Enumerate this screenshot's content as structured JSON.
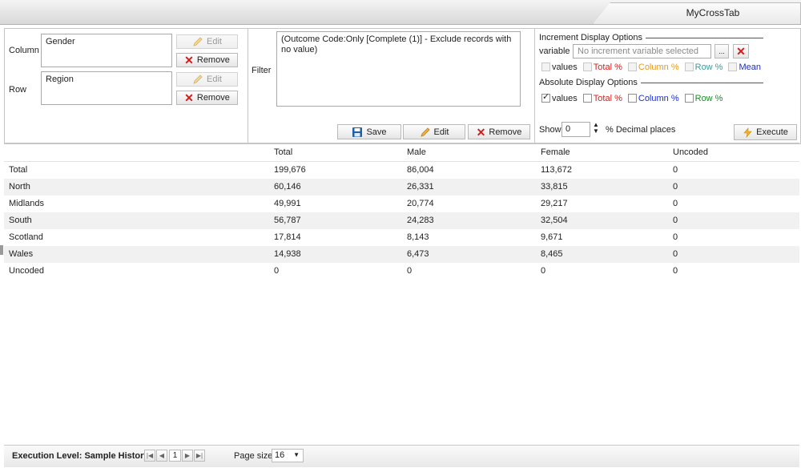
{
  "window": {
    "tab_title": "MyCrossTab"
  },
  "dimensions": {
    "column_label": "Column",
    "column_value": "Gender",
    "row_label": "Row",
    "row_value": "Region",
    "edit_label": "Edit",
    "remove_label": "Remove"
  },
  "filter": {
    "label": "Filter",
    "text": "(Outcome Code:Only [Complete (1)] - Exclude records with no value)",
    "save_label": "Save",
    "edit_label": "Edit",
    "remove_label": "Remove"
  },
  "increment": {
    "title": "Increment Display Options",
    "variable_label": "variable",
    "placeholder": "No increment variable selected",
    "browse_label": "...",
    "options": [
      {
        "label": "values",
        "color": "#222222"
      },
      {
        "label": "Total %",
        "color": "#d62020"
      },
      {
        "label": "Column %",
        "color": "#e89a1a"
      },
      {
        "label": "Row %",
        "color": "#3d9a9a"
      },
      {
        "label": "Mean",
        "color": "#2030b0"
      }
    ]
  },
  "absolute": {
    "title": "Absolute Display Options",
    "options": [
      {
        "label": "values",
        "color": "#222222",
        "checked": true
      },
      {
        "label": "Total %",
        "color": "#d62020",
        "checked": false
      },
      {
        "label": "Column %",
        "color": "#1a2fd0",
        "checked": false
      },
      {
        "label": "Row %",
        "color": "#1a8a2a",
        "checked": false
      }
    ]
  },
  "decimal": {
    "show_label": "Show",
    "value": "0",
    "suffix": "% Decimal places"
  },
  "execute_label": "Execute",
  "table": {
    "headers": [
      "",
      "Total",
      "Male",
      "Female",
      "Uncoded"
    ],
    "rows": [
      [
        "Total",
        "199,676",
        "86,004",
        "113,672",
        "0"
      ],
      [
        "North",
        "60,146",
        "26,331",
        "33,815",
        "0"
      ],
      [
        "Midlands",
        "49,991",
        "20,774",
        "29,217",
        "0"
      ],
      [
        "South",
        "56,787",
        "24,283",
        "32,504",
        "0"
      ],
      [
        "Scotland",
        "17,814",
        "8,143",
        "9,671",
        "0"
      ],
      [
        "Wales",
        "14,938",
        "6,473",
        "8,465",
        "0"
      ],
      [
        "Uncoded",
        "0",
        "0",
        "0",
        "0"
      ]
    ]
  },
  "footer": {
    "execution_level": "Execution Level: Sample History",
    "page": "1",
    "page_size_label": "Page size:",
    "page_size": "16"
  }
}
